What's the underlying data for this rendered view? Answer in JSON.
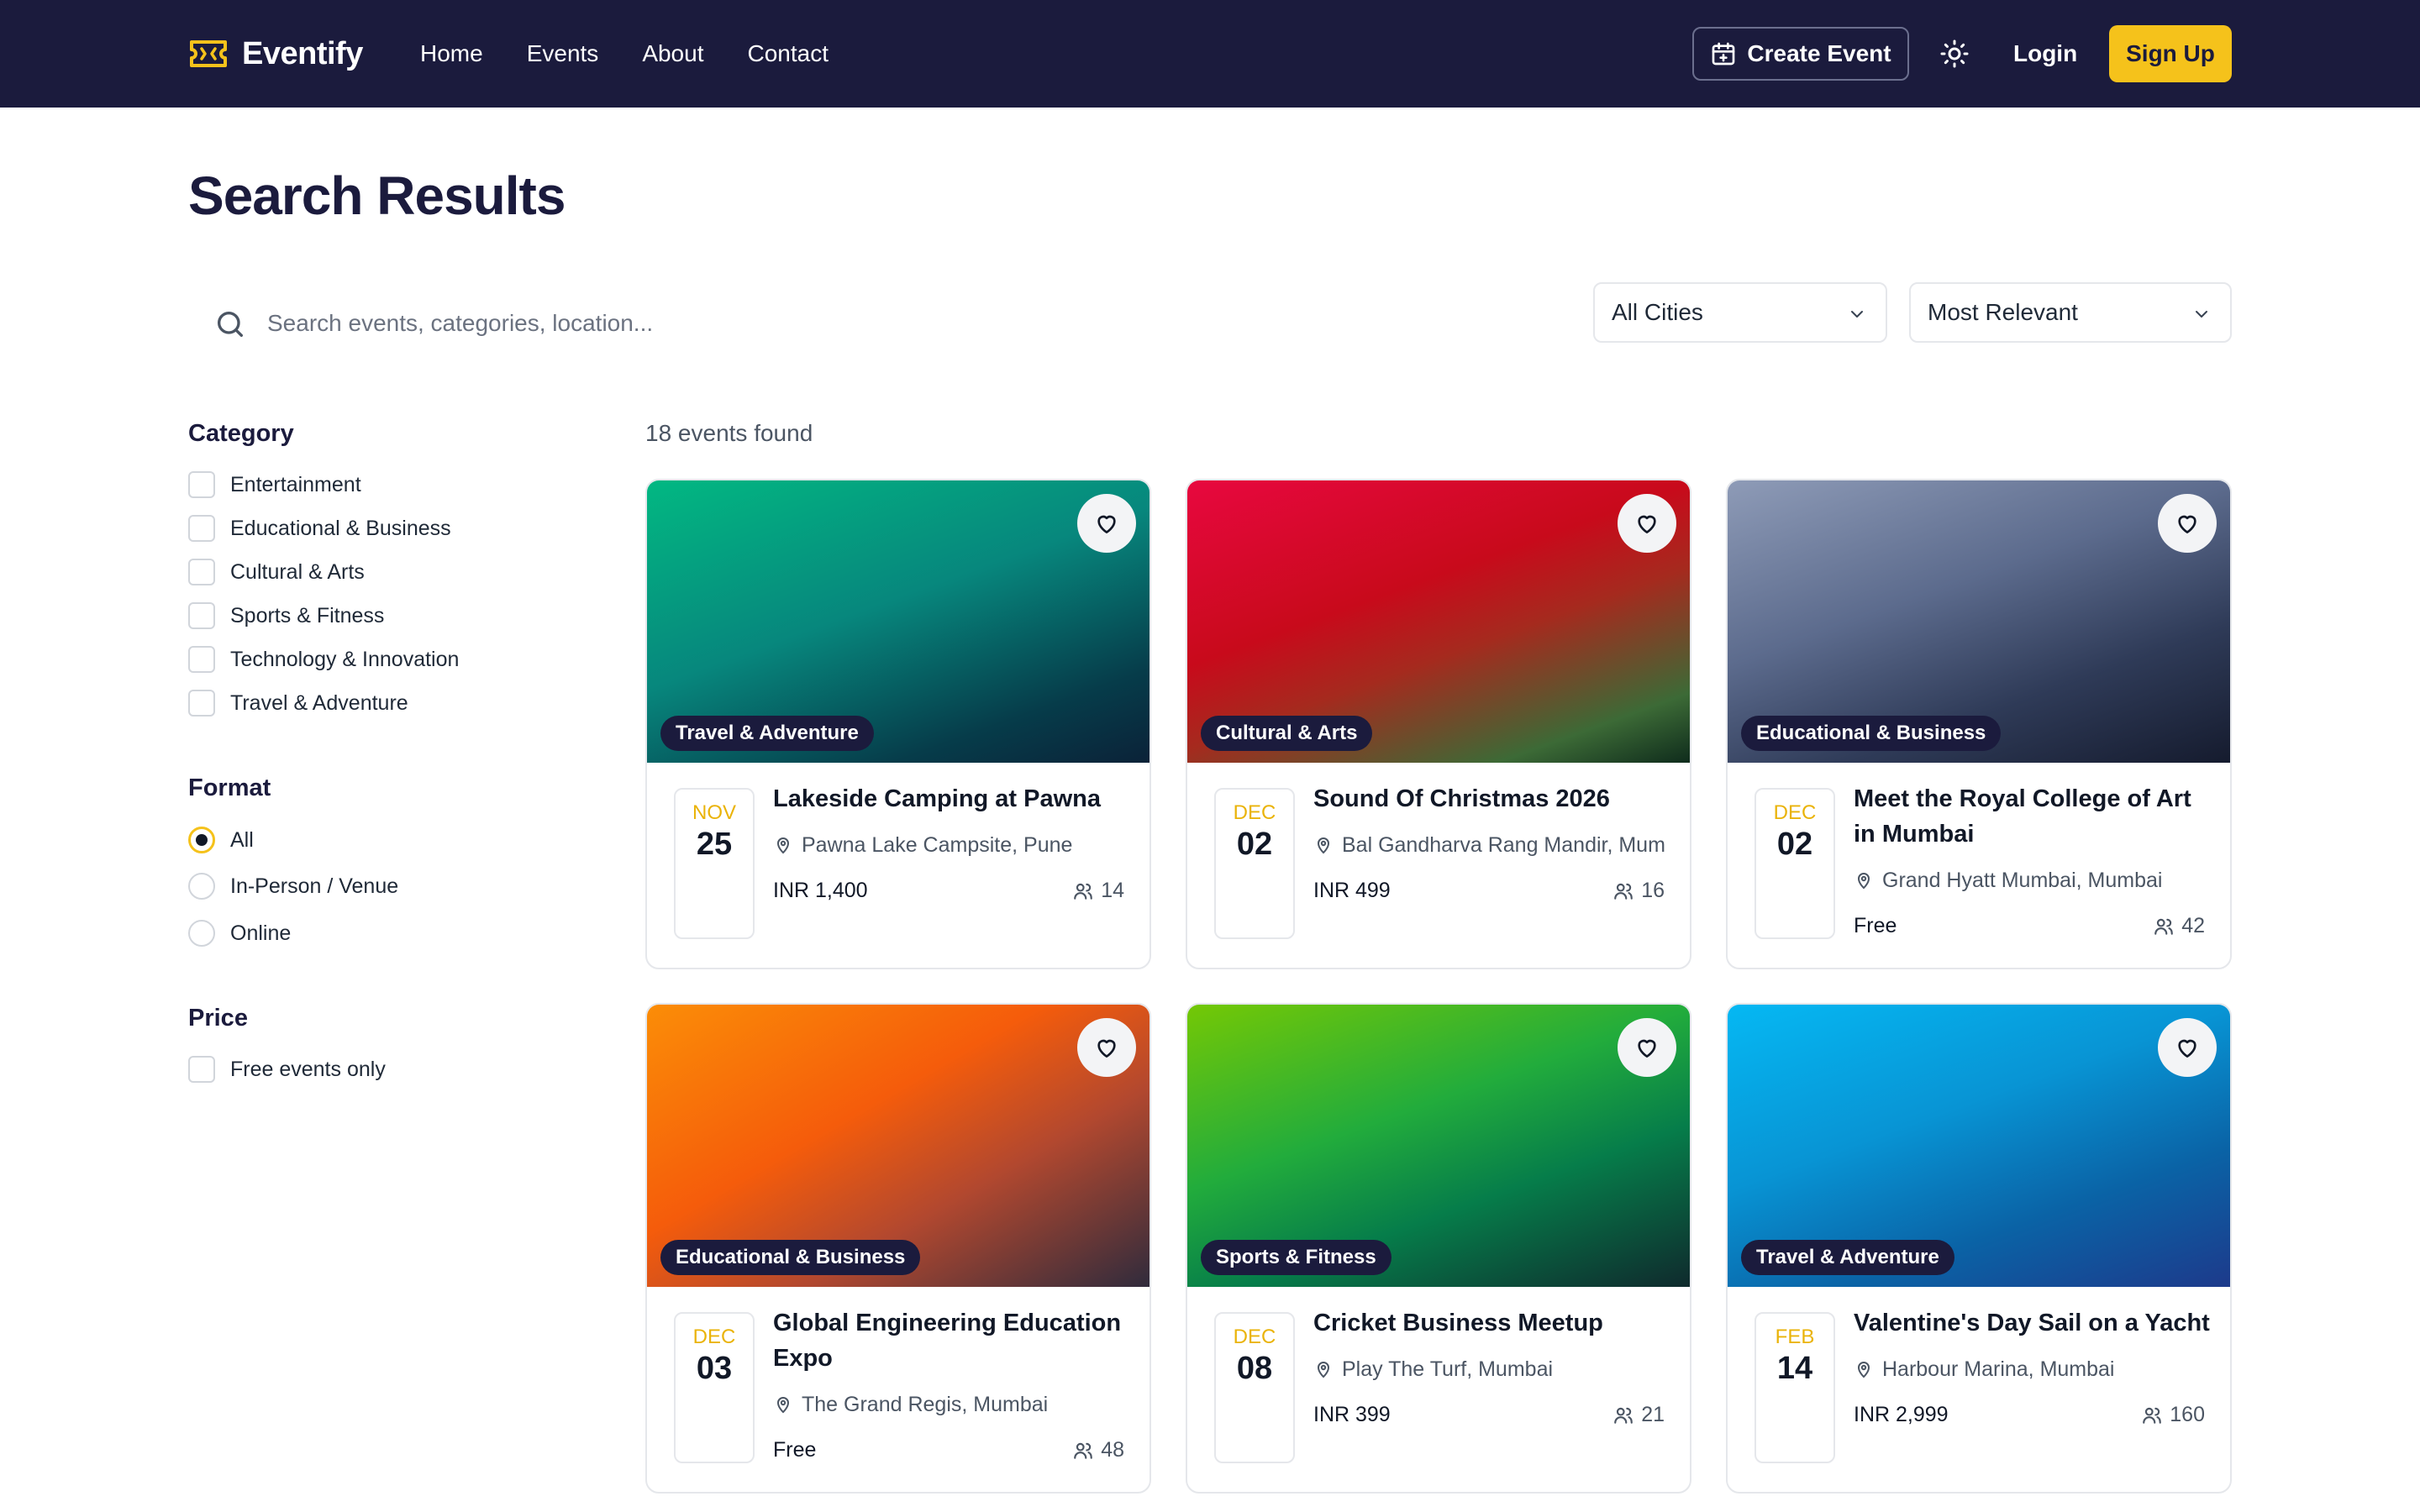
{
  "brand": {
    "name": "Eventify"
  },
  "nav": {
    "links": [
      "Home",
      "Events",
      "About",
      "Contact"
    ],
    "create_event": "Create Event",
    "login": "Login",
    "signup": "Sign Up"
  },
  "page": {
    "title": "Search Results"
  },
  "search": {
    "placeholder": "Search events, categories, location...",
    "value": ""
  },
  "filters": {
    "city": "All Cities",
    "sort": "Most Relevant",
    "category": {
      "heading": "Category",
      "options": [
        "Entertainment",
        "Educational & Business",
        "Cultural & Arts",
        "Sports & Fitness",
        "Technology & Innovation",
        "Travel & Adventure"
      ]
    },
    "format": {
      "heading": "Format",
      "options": [
        "All",
        "In-Person / Venue",
        "Online"
      ],
      "selected": "All"
    },
    "price": {
      "heading": "Price",
      "options": [
        "Free events only"
      ]
    }
  },
  "results": {
    "count_text": "18 events found",
    "events": [
      {
        "category": "Travel & Adventure",
        "month": "NOV",
        "day": "25",
        "title": "Lakeside Camping at Pawna",
        "location": "Pawna Lake Campsite, Pune",
        "price": "INR 1,400",
        "attendees": "14"
      },
      {
        "category": "Cultural & Arts",
        "month": "DEC",
        "day": "02",
        "title": "Sound Of Christmas 2026",
        "location": "Bal Gandharva Rang Mandir, Mum",
        "price": "INR 499",
        "attendees": "16"
      },
      {
        "category": "Educational & Business",
        "month": "DEC",
        "day": "02",
        "title": "Meet the Royal College of Art in Mumbai",
        "location": "Grand Hyatt Mumbai, Mumbai",
        "price": "Free",
        "attendees": "42"
      },
      {
        "category": "Educational & Business",
        "month": "DEC",
        "day": "03",
        "title": "Global Engineering Education Expo",
        "location": "The Grand Regis, Mumbai",
        "price": "Free",
        "attendees": "48"
      },
      {
        "category": "Sports & Fitness",
        "month": "DEC",
        "day": "08",
        "title": "Cricket Business Meetup",
        "location": "Play The Turf, Mumbai",
        "price": "INR 399",
        "attendees": "21"
      },
      {
        "category": "Travel & Adventure",
        "month": "FEB",
        "day": "14",
        "title": "Valentine's Day Sail on a Yacht",
        "location": "Harbour Marina, Mumbai",
        "price": "INR 2,999",
        "attendees": "160"
      }
    ]
  },
  "colors": {
    "navbar": "#1b1b3d",
    "accent": "#f5c21b",
    "date_month": "#eab308"
  }
}
